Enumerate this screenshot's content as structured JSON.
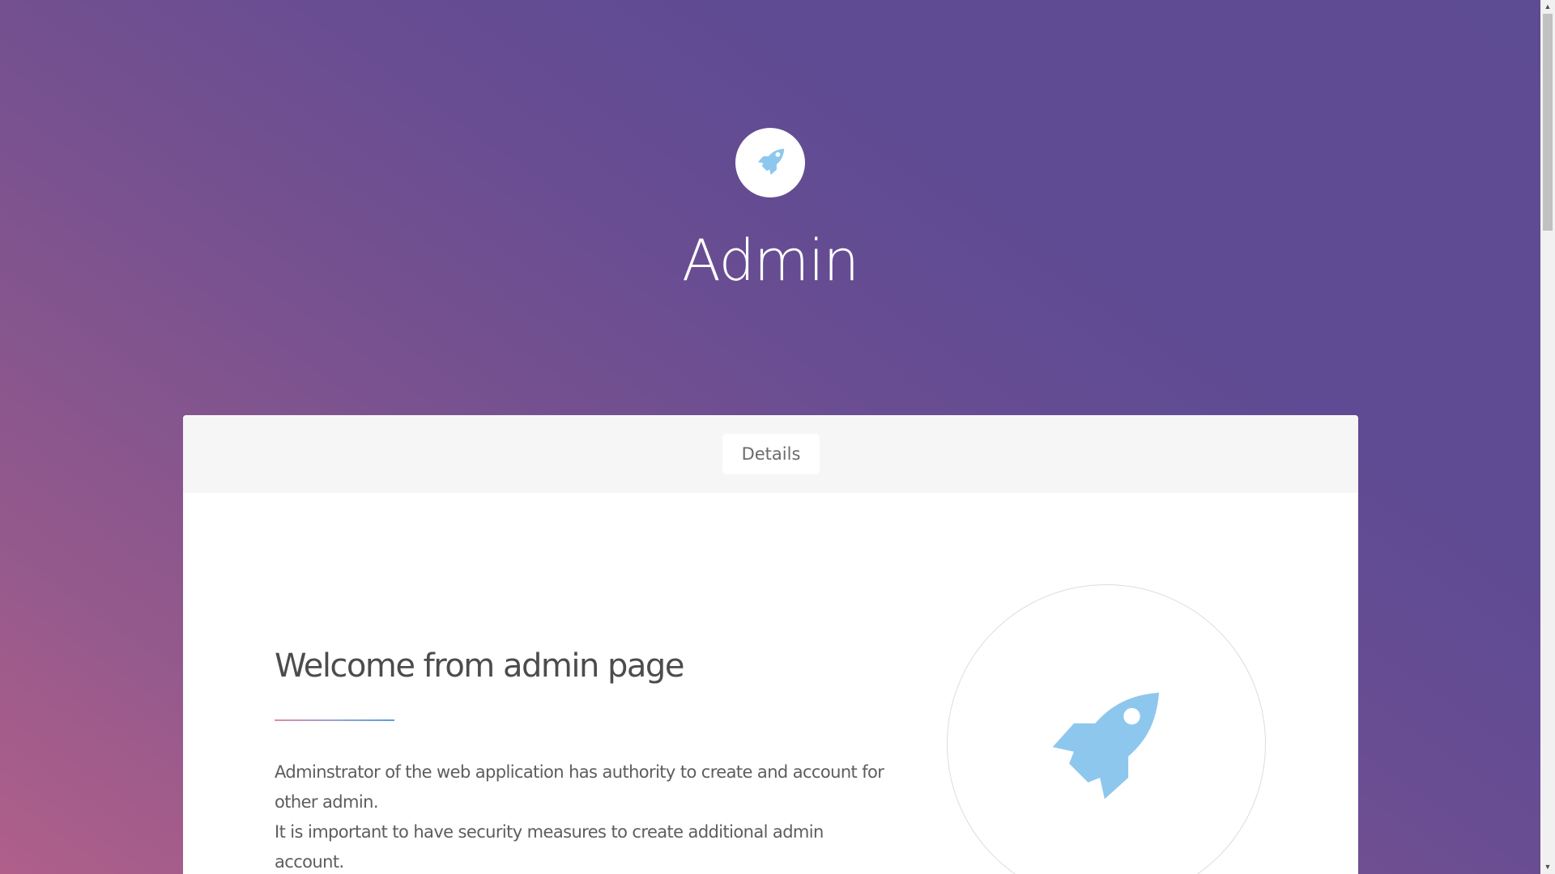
{
  "hero": {
    "icon": "rocket-icon",
    "title": "Admin"
  },
  "card": {
    "tabs": [
      {
        "label": "Details",
        "active": true
      }
    ],
    "welcome_title": "Welcome from admin page",
    "description": [
      "Adminstrator of the web application has authority to create and account for other admin.",
      "It is important to have security measures to create additional admin account."
    ],
    "illustration_icon": "rocket-icon"
  },
  "colors": {
    "gradient_start": "#b05f8a",
    "gradient_end": "#5d4b94",
    "rocket": "#8ec7ee",
    "card_header": "#f6f6f6",
    "divider_start": "#e38aa6",
    "divider_end": "#5aa0da"
  },
  "scrollbar": {
    "up_icon": "scroll-up-arrow-icon",
    "down_icon": "scroll-down-arrow-icon"
  }
}
